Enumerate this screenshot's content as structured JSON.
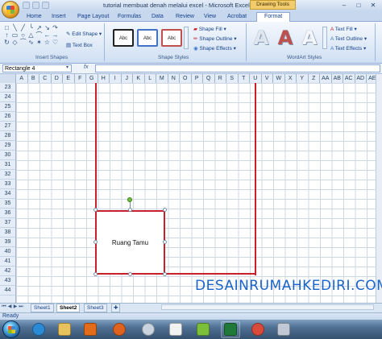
{
  "window": {
    "title": "tutorial membuat denah melalui excel - Microsoft Excel",
    "context_tab": "Drawing Tools",
    "controls": [
      "–",
      "□",
      "✕"
    ]
  },
  "tabs": [
    "Home",
    "Insert",
    "Page Layout",
    "Formulas",
    "Data",
    "Review",
    "View",
    "Acrobat",
    "Format"
  ],
  "active_tab": "Format",
  "ribbon": {
    "insert_shapes": {
      "label": "Insert Shapes",
      "edit_shape": "Edit Shape",
      "text_box": "Text Box",
      "shape_icons": [
        "□",
        "╲",
        "╱",
        "╰",
        "↗",
        "↘",
        "↷",
        "↑",
        "▭",
        "○",
        "△",
        "⌒",
        "←",
        "→",
        "↻",
        "◇",
        "⏜",
        "∿",
        "✶",
        "☆",
        "♡"
      ]
    },
    "shape_styles": {
      "label": "Shape Styles",
      "samples": [
        "Abc",
        "Abc",
        "Abc"
      ],
      "sample_colors": [
        "#222222",
        "#4472c4",
        "#c0504d"
      ],
      "shape_fill": "Shape Fill",
      "shape_outline": "Shape Outline",
      "shape_effects": "Shape Effects"
    },
    "wordart_styles": {
      "label": "WordArt Styles",
      "samples": [
        "A",
        "A",
        "A"
      ],
      "sample_colors": [
        "#dfe6f0",
        "#c0504d",
        "#f4f6f9"
      ],
      "text_fill": "Text Fill",
      "text_outline": "Text Outline",
      "text_effects": "Text Effects"
    }
  },
  "formula_bar": {
    "name_box": "Rectangle 4",
    "fx": "fx",
    "value": ""
  },
  "columns": [
    "A",
    "B",
    "C",
    "D",
    "E",
    "F",
    "G",
    "H",
    "I",
    "J",
    "K",
    "L",
    "M",
    "N",
    "O",
    "P",
    "Q",
    "R",
    "S",
    "T",
    "U",
    "V",
    "W",
    "X",
    "Y",
    "Z",
    "AA",
    "AB",
    "AC",
    "AD",
    "AE"
  ],
  "rows": [
    "23",
    "24",
    "25",
    "26",
    "27",
    "28",
    "29",
    "30",
    "31",
    "32",
    "33",
    "34",
    "35",
    "36",
    "37",
    "38",
    "39",
    "40",
    "41",
    "42",
    "43",
    "44"
  ],
  "drawing": {
    "room_label": "Ruang Tamu",
    "line_color": "#c8202a"
  },
  "watermark": "DESAINRUMAHKEDIRI.COM",
  "sheets": [
    "Sheet1",
    "Sheet2",
    "Sheet3"
  ],
  "active_sheet": "Sheet2",
  "status": "Ready",
  "taskbar_icons": [
    "internet-explorer-icon",
    "folder-icon",
    "media-player-icon",
    "firefox-icon",
    "cd-icon",
    "paint-icon",
    "office-icon",
    "excel-icon",
    "chrome-icon",
    "pen-icon"
  ]
}
